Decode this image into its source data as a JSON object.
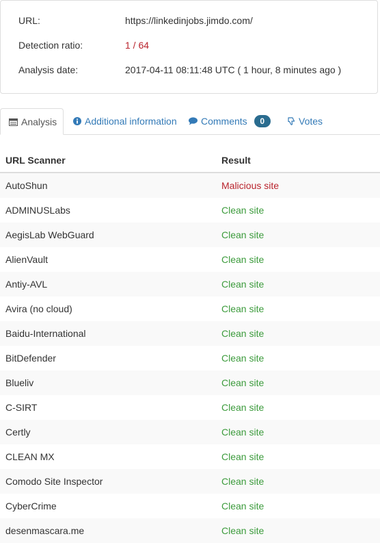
{
  "info": {
    "url_label": "URL:",
    "url_value": "https://linkedinjobs.jimdo.com/",
    "ratio_label": "Detection ratio:",
    "ratio_value": "1 / 64",
    "date_label": "Analysis date:",
    "date_value": "2017-04-11 08:11:48 UTC ( 1 hour, 8 minutes ago )"
  },
  "tabs": {
    "analysis": "Analysis",
    "additional": "Additional information",
    "comments": "Comments",
    "comments_count": "0",
    "votes": "Votes"
  },
  "table": {
    "headers": [
      "URL Scanner",
      "Result"
    ],
    "rows": [
      {
        "scanner": "AutoShun",
        "result": "Malicious site",
        "status": "malicious"
      },
      {
        "scanner": "ADMINUSLabs",
        "result": "Clean site",
        "status": "clean"
      },
      {
        "scanner": "AegisLab WebGuard",
        "result": "Clean site",
        "status": "clean"
      },
      {
        "scanner": "AlienVault",
        "result": "Clean site",
        "status": "clean"
      },
      {
        "scanner": "Antiy-AVL",
        "result": "Clean site",
        "status": "clean"
      },
      {
        "scanner": "Avira (no cloud)",
        "result": "Clean site",
        "status": "clean"
      },
      {
        "scanner": "Baidu-International",
        "result": "Clean site",
        "status": "clean"
      },
      {
        "scanner": "BitDefender",
        "result": "Clean site",
        "status": "clean"
      },
      {
        "scanner": "Blueliv",
        "result": "Clean site",
        "status": "clean"
      },
      {
        "scanner": "C-SIRT",
        "result": "Clean site",
        "status": "clean"
      },
      {
        "scanner": "Certly",
        "result": "Clean site",
        "status": "clean"
      },
      {
        "scanner": "CLEAN MX",
        "result": "Clean site",
        "status": "clean"
      },
      {
        "scanner": "Comodo Site Inspector",
        "result": "Clean site",
        "status": "clean"
      },
      {
        "scanner": "CyberCrime",
        "result": "Clean site",
        "status": "clean"
      },
      {
        "scanner": "desenmascara.me",
        "result": "Clean site",
        "status": "clean"
      }
    ]
  },
  "colors": {
    "clean": "#3c9b3c",
    "malicious": "#b9242d",
    "link": "#337ab7",
    "badge": "#2a6c8f"
  },
  "icons": {
    "analysis": "table-icon",
    "additional": "info-circle-icon",
    "comments": "comment-icon",
    "votes": "thumbs-down-icon"
  }
}
